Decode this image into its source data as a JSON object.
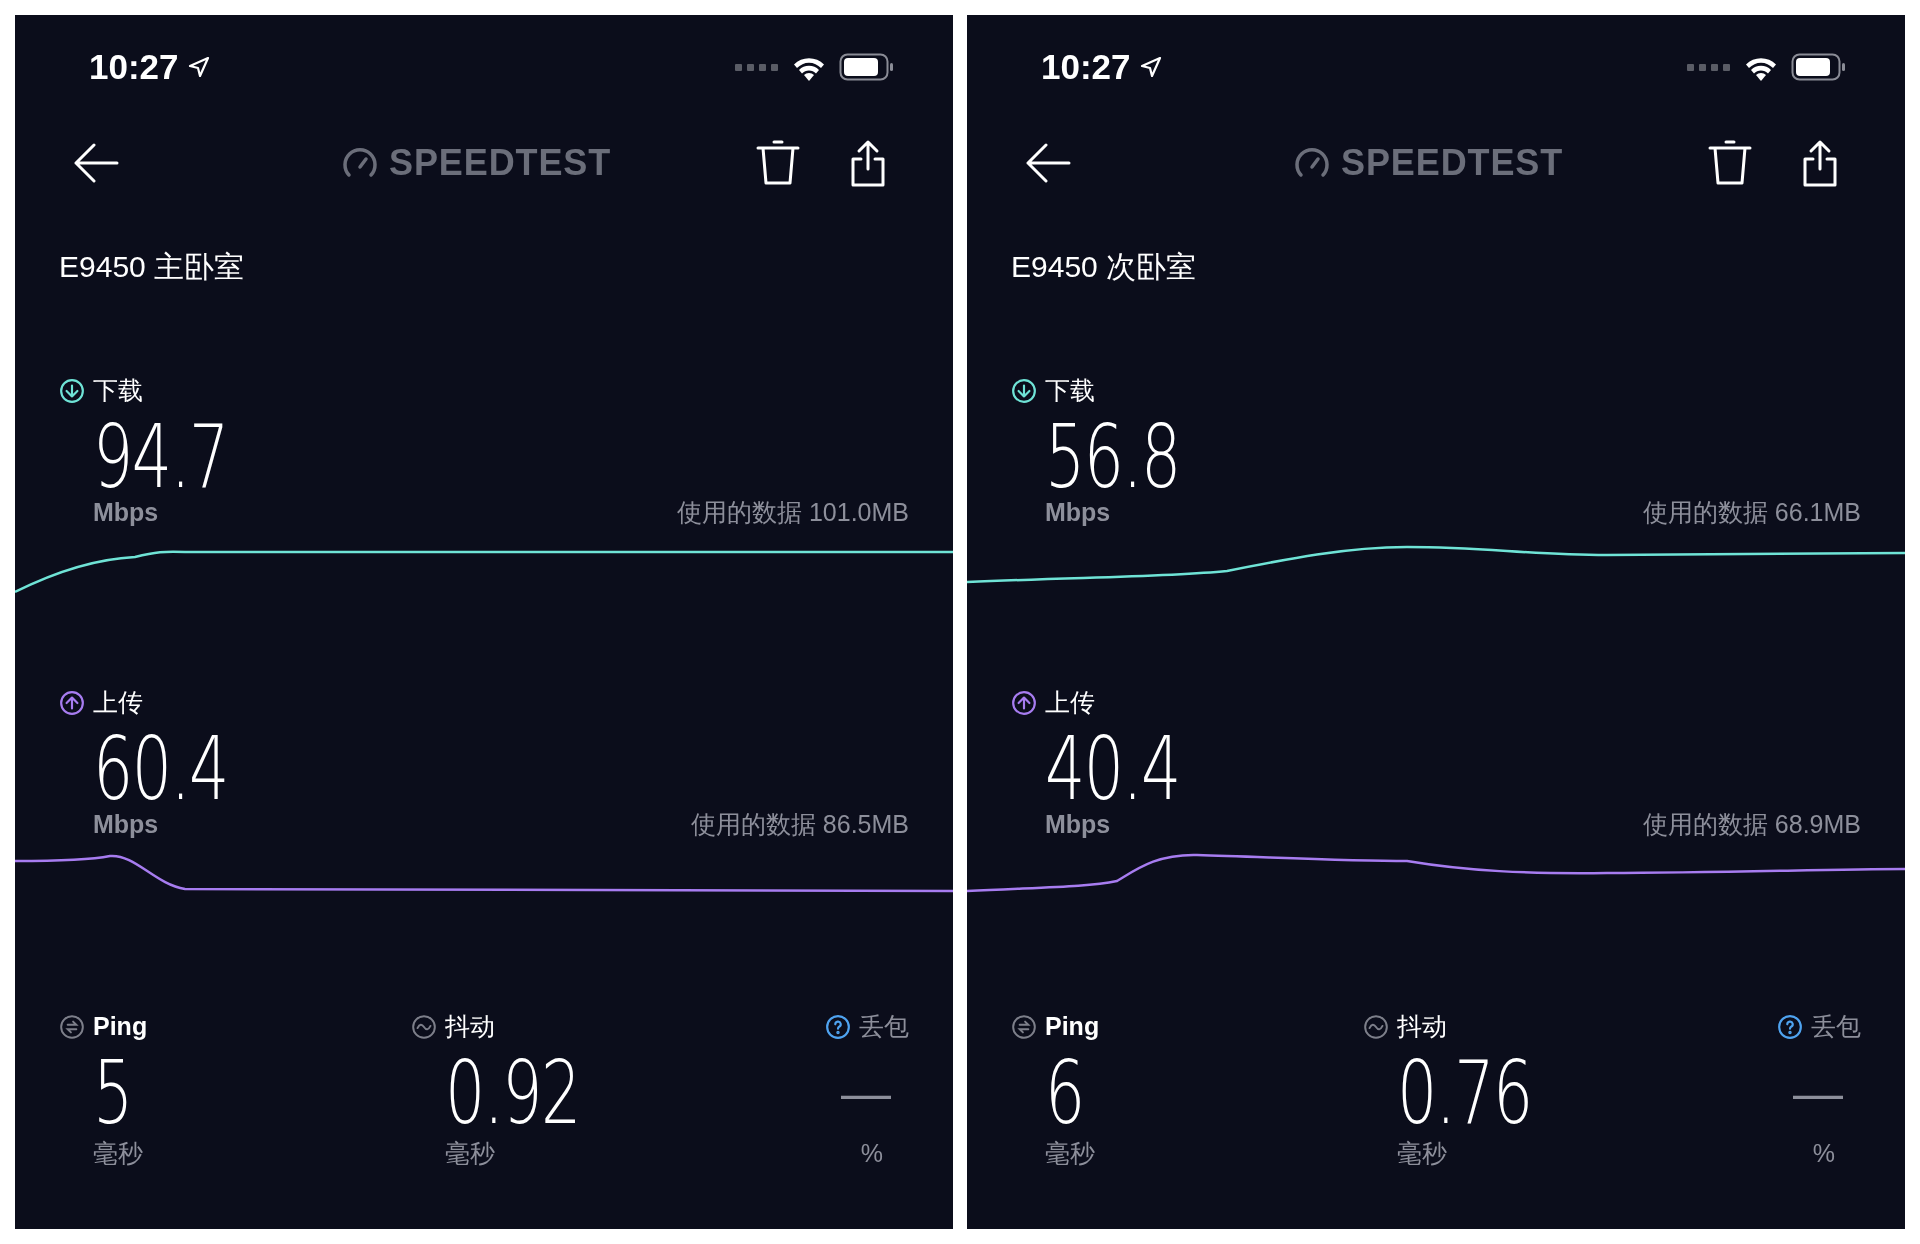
{
  "panels": [
    {
      "status_bar": {
        "time": "10:27"
      },
      "header": {
        "logo": "SPEEDTEST"
      },
      "title": "E9450 主卧室",
      "download": {
        "label": "下载",
        "value": "94.7",
        "unit": "Mbps",
        "data_used": "使用的数据 101.0MB"
      },
      "upload": {
        "label": "上传",
        "value": "60.4",
        "unit": "Mbps",
        "data_used": "使用的数据 86.5MB"
      },
      "metrics": [
        {
          "kind": "ping",
          "label": "Ping",
          "value": "5",
          "unit": "毫秒"
        },
        {
          "kind": "jitter",
          "label": "抖动",
          "value": "0.92",
          "unit": "毫秒"
        },
        {
          "kind": "loss",
          "label": "丢包",
          "value": "—",
          "unit": "%"
        }
      ]
    },
    {
      "status_bar": {
        "time": "10:27"
      },
      "header": {
        "logo": "SPEEDTEST"
      },
      "title": "E9450 次卧室",
      "download": {
        "label": "下载",
        "value": "56.8",
        "unit": "Mbps",
        "data_used": "使用的数据 66.1MB"
      },
      "upload": {
        "label": "上传",
        "value": "40.4",
        "unit": "Mbps",
        "data_used": "使用的数据 68.9MB"
      },
      "metrics": [
        {
          "kind": "ping",
          "label": "Ping",
          "value": "6",
          "unit": "毫秒"
        },
        {
          "kind": "jitter",
          "label": "抖动",
          "value": "0.76",
          "unit": "毫秒"
        },
        {
          "kind": "loss",
          "label": "丢包",
          "value": "—",
          "unit": "%"
        }
      ]
    }
  ]
}
